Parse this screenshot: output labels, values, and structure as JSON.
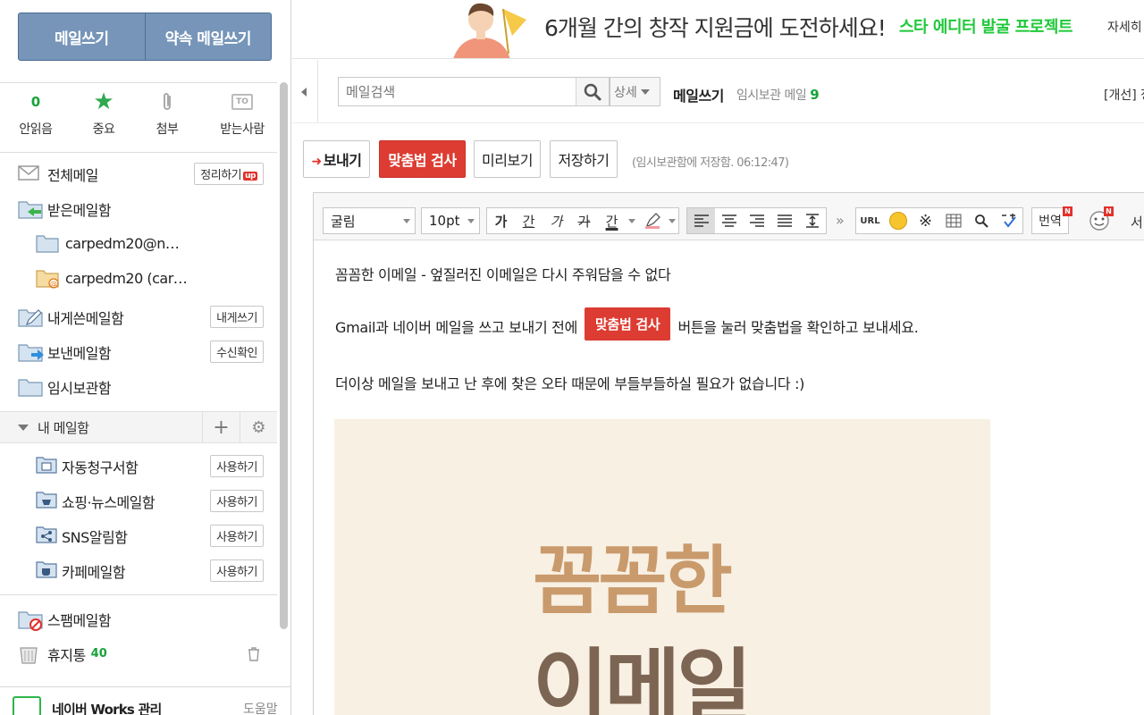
{
  "sidebar": {
    "compose_label": "메일쓰기",
    "promise_compose_label": "약속 메일쓰기",
    "quick": {
      "unread_count": "0",
      "unread_label": "안읽음",
      "important_label": "중요",
      "attach_label": "첨부",
      "to_me_icon_text": "TO",
      "to_me_label": "받는사람"
    },
    "all_mail": {
      "label": "전체메일",
      "btn": "정리하기",
      "badge": "up"
    },
    "inbox": {
      "label": "받은메일함"
    },
    "sub1": {
      "label": "carpedm20@n…"
    },
    "sub2": {
      "label": "carpedm20 (car…"
    },
    "self_sent": {
      "label": "내게쓴메일함",
      "btn": "내게쓰기"
    },
    "sent": {
      "label": "보낸메일함",
      "btn": "수신확인"
    },
    "drafts": {
      "label": "임시보관함"
    },
    "my_box": {
      "label": "내 메일함"
    },
    "my_items": [
      {
        "label": "자동청구서함",
        "btn": "사용하기"
      },
      {
        "label": "쇼핑·뉴스메일함",
        "btn": "사용하기"
      },
      {
        "label": "SNS알림함",
        "btn": "사용하기"
      },
      {
        "label": "카페메일함",
        "btn": "사용하기"
      }
    ],
    "spam": {
      "label": "스팸메일함"
    },
    "trash": {
      "label": "휴지통",
      "count": "40"
    },
    "bottom": {
      "works": "네이버 Works 관리",
      "help": "도움말"
    }
  },
  "banner": {
    "text": "6개월 간의 창작 지원금에 도전하세요!",
    "project": "스타 에디터 발굴 프로젝트",
    "more": "자세히"
  },
  "header": {
    "search_placeholder": "메일검색",
    "detail": "상세",
    "title": "메일쓰기",
    "drafts_label": "임시보관 메일",
    "drafts_count": "9",
    "improve": "[개선] 정"
  },
  "actions": {
    "send": "보내기",
    "spell": "맞춤법 검사",
    "preview": "미리보기",
    "save": "저장하기",
    "saved_note": "(임시보관함에 저장함. 06:12:47)"
  },
  "editor_toolbar": {
    "font": "굴림",
    "size": "10pt",
    "bold": "가",
    "underline": "간",
    "italic": "가",
    "strike": "가",
    "color": "간",
    "more": "»",
    "url": "URL",
    "translate": "번역",
    "new_badge": "N",
    "trailing": "서"
  },
  "body": {
    "line1": "꼼꼼한 이메일 - 엎질러진 이메일은 다시 주워담을 수 없다",
    "line2_pre": "Gmail과 네이버 메일을 쓰고 보내기 전에",
    "line2_btn": "맞춤법 검사",
    "line2_post": "버튼을 눌러 맞춤법을 확인하고 보내세요.",
    "line3": "더이상 메일을 보내고 난 후에 찾은 오타 때문에 부들부들하실 필요가 없습니다 :)",
    "poster_word1": "꼼꼼한",
    "poster_word2": "이메일"
  },
  "colors": {
    "compose_bg": "#7695b9",
    "accent_red": "#dc3c32",
    "green": "#16a33a",
    "banner_green": "#20c83a",
    "poster_bg": "#f8f0e3",
    "poster_word1": "#c99a6c",
    "poster_word2": "#7d6554"
  }
}
